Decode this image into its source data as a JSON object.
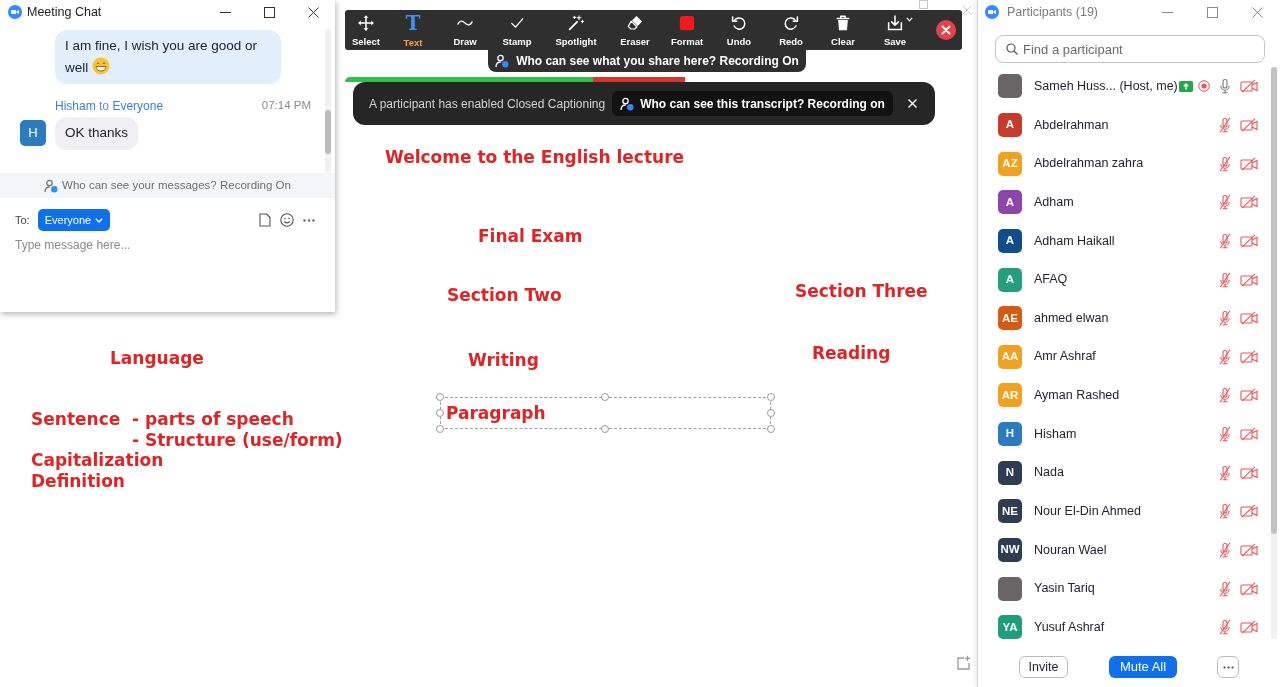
{
  "chat_window": {
    "title": "Meeting Chat",
    "messages": [
      {
        "kind": "outgoing",
        "text": "I am fine, I wish you are good or well",
        "emoji": true
      },
      {
        "kind": "incoming",
        "sender": "Hisham",
        "connector": "to",
        "recipient": "Everyone",
        "time": "07:14 PM",
        "avatar": "H",
        "text": "OK thanks",
        "emoji": false
      }
    ],
    "privacy_notice": "Who can see your messages? Recording On",
    "to_label": "To:",
    "recipient_button": "Everyone",
    "message_input": {
      "placeholder": "Type message here..."
    }
  },
  "annotation_toolbar": {
    "tools": [
      {
        "label": "Select",
        "selected": false
      },
      {
        "label": "Text",
        "glyph": "T",
        "selected": true
      },
      {
        "label": "Draw",
        "selected": false
      },
      {
        "label": "Stamp",
        "selected": false
      },
      {
        "label": "Spotlight",
        "selected": false
      },
      {
        "label": "Eraser",
        "selected": false
      },
      {
        "label": "Format",
        "selected": false
      },
      {
        "label": "Undo",
        "selected": false
      },
      {
        "label": "Redo",
        "selected": false
      },
      {
        "label": "Clear",
        "selected": false
      },
      {
        "label": "Save",
        "selected": false
      }
    ]
  },
  "share_notice": "Who can see what you share here? Recording On",
  "caption_banner": {
    "message": "A participant has enabled Closed Captioning",
    "transcript_notice": "Who can see this transcript? Recording on"
  },
  "whiteboard": {
    "annotations": [
      {
        "text": "Welcome to the English lecture",
        "selected": false
      },
      {
        "text": "Final Exam",
        "selected": false
      },
      {
        "text": "Section Two",
        "selected": false
      },
      {
        "text": "Section Three",
        "selected": false
      },
      {
        "text": "Language",
        "selected": false
      },
      {
        "text": "Writing",
        "selected": false
      },
      {
        "text": "Reading",
        "selected": false
      },
      {
        "text": "Sentence  - parts of speech",
        "selected": false
      },
      {
        "text": "- Structure (use/form)",
        "selected": false
      },
      {
        "text": "Capitalization",
        "selected": false
      },
      {
        "text": "Definition",
        "selected": false
      },
      {
        "text": "Paragraph",
        "selected": true
      }
    ]
  },
  "participants_panel": {
    "title": "Participants (19)",
    "search": {
      "placeholder": "Find a participant"
    },
    "participants": [
      {
        "kind": "photo",
        "name": "Sameh Huss... (Host, me)",
        "mic_muted": false,
        "video_off": true,
        "sharing": true,
        "recording": true
      },
      {
        "kind": "initials",
        "initials": "A",
        "color": "#c83a2b",
        "name": "Abdelrahman",
        "mic_muted": true,
        "video_off": true,
        "sharing": false,
        "recording": false
      },
      {
        "kind": "initials",
        "initials": "AZ",
        "color": "#f2a11f",
        "name": "Abdelrahman zahra",
        "mic_muted": true,
        "video_off": true,
        "sharing": false,
        "recording": false
      },
      {
        "kind": "initials",
        "initials": "A",
        "color": "#8e44ad",
        "name": "Adham",
        "mic_muted": true,
        "video_off": true,
        "sharing": false,
        "recording": false
      },
      {
        "kind": "initials",
        "initials": "A",
        "color": "#0f4e8a",
        "name": "Adham Haikall",
        "mic_muted": true,
        "video_off": true,
        "sharing": false,
        "recording": false
      },
      {
        "kind": "initials",
        "initials": "A",
        "color": "#22a07e",
        "name": "AFAQ",
        "mic_muted": true,
        "video_off": true,
        "sharing": false,
        "recording": false
      },
      {
        "kind": "initials",
        "initials": "AE",
        "color": "#d65a12",
        "name": "ahmed elwan",
        "mic_muted": true,
        "video_off": true,
        "sharing": false,
        "recording": false
      },
      {
        "kind": "initials",
        "initials": "AA",
        "color": "#f2a11f",
        "name": "Amr Ashraf",
        "mic_muted": true,
        "video_off": true,
        "sharing": false,
        "recording": false
      },
      {
        "kind": "initials",
        "initials": "AR",
        "color": "#f2a11f",
        "name": "Ayman Rashed",
        "mic_muted": true,
        "video_off": true,
        "sharing": false,
        "recording": false
      },
      {
        "kind": "initials",
        "initials": "H",
        "color": "#2b7bbf",
        "name": "Hisham",
        "mic_muted": true,
        "video_off": true,
        "sharing": false,
        "recording": false
      },
      {
        "kind": "initials",
        "initials": "N",
        "color": "#2f3d52",
        "name": "Nada",
        "mic_muted": true,
        "video_off": true,
        "sharing": false,
        "recording": false
      },
      {
        "kind": "initials",
        "initials": "NE",
        "color": "#2f3d52",
        "name": "Nour El-Din Ahmed",
        "mic_muted": true,
        "video_off": true,
        "sharing": false,
        "recording": false
      },
      {
        "kind": "initials",
        "initials": "NW",
        "color": "#2f3d52",
        "name": "Nouran Wael",
        "mic_muted": true,
        "video_off": true,
        "sharing": false,
        "recording": false
      },
      {
        "kind": "photo",
        "name": "Yasin Tariq",
        "mic_muted": true,
        "video_off": true,
        "sharing": false,
        "recording": false
      },
      {
        "kind": "initials",
        "initials": "YA",
        "color": "#1e9f7c",
        "name": "Yusuf Ashraf",
        "mic_muted": true,
        "video_off": true,
        "sharing": false,
        "recording": false
      }
    ],
    "buttons": [
      {
        "label": "Invite",
        "kind": "outline"
      },
      {
        "label": "Mute All",
        "kind": "primary"
      }
    ]
  }
}
